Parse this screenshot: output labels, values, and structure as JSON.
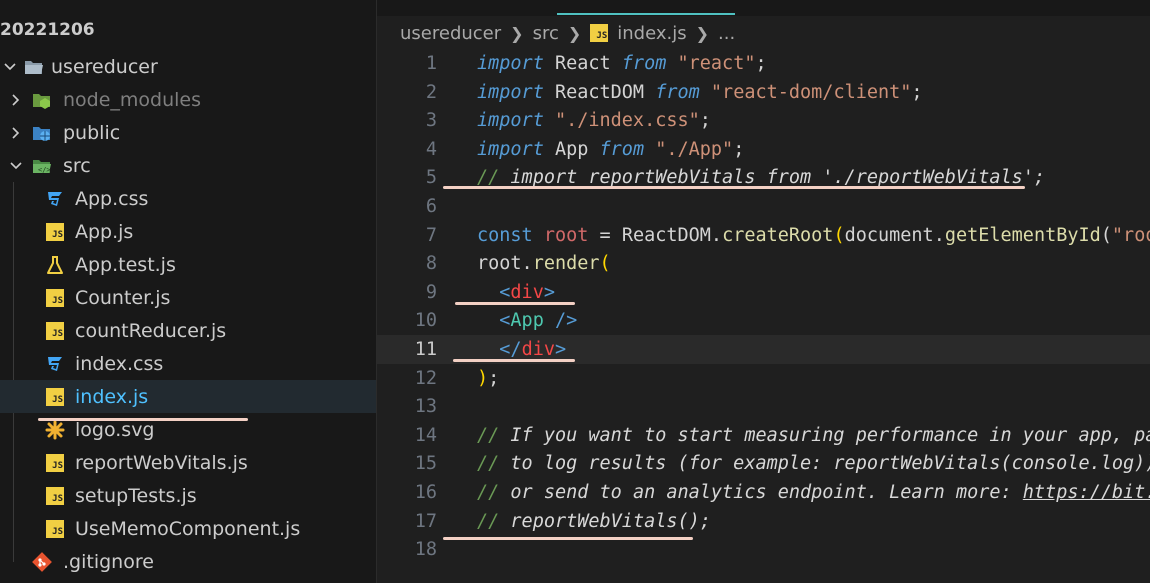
{
  "sidebar": {
    "root_folder": "20221206",
    "tree": [
      {
        "label": "usereducer",
        "kind": "folder",
        "icon": "folder-open-icon",
        "expanded": true,
        "depth": 0
      },
      {
        "label": "node_modules",
        "kind": "folder",
        "icon": "node-folder-icon",
        "expanded": false,
        "depth": 1,
        "dim": true
      },
      {
        "label": "public",
        "kind": "folder",
        "icon": "public-folder-icon",
        "expanded": false,
        "depth": 1
      },
      {
        "label": "src",
        "kind": "folder",
        "icon": "src-folder-icon",
        "expanded": true,
        "depth": 1
      },
      {
        "label": "App.css",
        "kind": "file",
        "icon": "css-file-icon",
        "depth": 2
      },
      {
        "label": "App.js",
        "kind": "file",
        "icon": "js-file-icon",
        "depth": 2
      },
      {
        "label": "App.test.js",
        "kind": "file",
        "icon": "test-flask-icon",
        "depth": 2
      },
      {
        "label": "Counter.js",
        "kind": "file",
        "icon": "js-file-icon",
        "depth": 2
      },
      {
        "label": "countReducer.js",
        "kind": "file",
        "icon": "js-file-icon",
        "depth": 2
      },
      {
        "label": "index.css",
        "kind": "file",
        "icon": "css-file-icon",
        "depth": 2
      },
      {
        "label": "index.js",
        "kind": "file",
        "icon": "js-file-icon",
        "depth": 2,
        "selected": true
      },
      {
        "label": "logo.svg",
        "kind": "file",
        "icon": "svg-file-icon",
        "depth": 2
      },
      {
        "label": "reportWebVitals.js",
        "kind": "file",
        "icon": "js-file-icon",
        "depth": 2
      },
      {
        "label": "setupTests.js",
        "kind": "file",
        "icon": "js-file-icon",
        "depth": 2
      },
      {
        "label": "UseMemoComponent.js",
        "kind": "file",
        "icon": "js-file-icon",
        "depth": 2
      },
      {
        "label": ".gitignore",
        "kind": "file",
        "icon": "git-file-icon",
        "depth": 1
      }
    ]
  },
  "editor": {
    "breadcrumb": [
      "usereducer",
      "src",
      "index.js",
      "..."
    ],
    "breadcrumb_file_badge": "JS",
    "current_line": 11,
    "lines": [
      {
        "n": 1,
        "tokens": [
          [
            "kw",
            "import"
          ],
          [
            "t",
            " React "
          ],
          [
            "kw",
            "from"
          ],
          [
            "t",
            " "
          ],
          [
            "str",
            "\"react\""
          ],
          [
            "t",
            ";"
          ]
        ]
      },
      {
        "n": 2,
        "tokens": [
          [
            "kw",
            "import"
          ],
          [
            "t",
            " ReactDOM "
          ],
          [
            "kw",
            "from"
          ],
          [
            "t",
            " "
          ],
          [
            "str",
            "\"react-dom/client\""
          ],
          [
            "t",
            ";"
          ]
        ]
      },
      {
        "n": 3,
        "tokens": [
          [
            "kw",
            "import"
          ],
          [
            "t",
            " "
          ],
          [
            "str",
            "\"./index.css\""
          ],
          [
            "t",
            ";"
          ]
        ]
      },
      {
        "n": 4,
        "tokens": [
          [
            "kw",
            "import"
          ],
          [
            "t",
            " App "
          ],
          [
            "kw",
            "from"
          ],
          [
            "t",
            " "
          ],
          [
            "str",
            "\"./App\""
          ],
          [
            "t",
            ";"
          ]
        ]
      },
      {
        "n": 5,
        "tokens": [
          [
            "cm",
            "// "
          ],
          [
            "cmt",
            "import reportWebVitals from './reportWebVitals';"
          ]
        ]
      },
      {
        "n": 6,
        "tokens": []
      },
      {
        "n": 7,
        "tokens": [
          [
            "kw2",
            "const"
          ],
          [
            "t",
            " "
          ],
          [
            "kwc",
            "root"
          ],
          [
            "t",
            " = ReactDOM."
          ],
          [
            "fn",
            "createRoot"
          ],
          [
            "bp",
            "("
          ],
          [
            "t",
            "document."
          ],
          [
            "fn",
            "getElementById"
          ],
          [
            "t",
            "("
          ],
          [
            "str",
            "\"root\""
          ],
          [
            "t",
            ")"
          ],
          [
            "bp",
            ")"
          ],
          [
            "t",
            ";"
          ]
        ]
      },
      {
        "n": 8,
        "tokens": [
          [
            "t",
            "root."
          ],
          [
            "fn",
            "render"
          ],
          [
            "bp",
            "("
          ]
        ]
      },
      {
        "n": 9,
        "tokens": [
          [
            "t",
            "  "
          ],
          [
            "tag",
            "<"
          ],
          [
            "tagname",
            "div"
          ],
          [
            "tag",
            ">"
          ]
        ]
      },
      {
        "n": 10,
        "tokens": [
          [
            "t",
            "  "
          ],
          [
            "tag",
            "<"
          ],
          [
            "comp",
            "App"
          ],
          [
            "t",
            " "
          ],
          [
            "tag",
            "/>"
          ]
        ]
      },
      {
        "n": 11,
        "tokens": [
          [
            "t",
            "  "
          ],
          [
            "tag",
            "</"
          ],
          [
            "tagname",
            "div"
          ],
          [
            "tag",
            ">"
          ]
        ]
      },
      {
        "n": 12,
        "tokens": [
          [
            "bp",
            ")"
          ],
          [
            "t",
            ";"
          ]
        ]
      },
      {
        "n": 13,
        "tokens": []
      },
      {
        "n": 14,
        "tokens": [
          [
            "cm",
            "// "
          ],
          [
            "cmt",
            "If you want to start measuring performance in your app, pass a"
          ]
        ]
      },
      {
        "n": 15,
        "tokens": [
          [
            "cm",
            "// "
          ],
          [
            "cmt",
            "to log results (for example: reportWebVitals(console.log))"
          ]
        ]
      },
      {
        "n": 16,
        "tokens": [
          [
            "cm",
            "// "
          ],
          [
            "cmt",
            "or send to an analytics endpoint. Learn more: "
          ],
          [
            "lnk",
            "https://bit.ly/CRA-vitals"
          ]
        ]
      },
      {
        "n": 17,
        "tokens": [
          [
            "cm",
            "// "
          ],
          [
            "cmt",
            "reportWebVitals();"
          ]
        ]
      },
      {
        "n": 18,
        "tokens": []
      }
    ]
  },
  "colors": {
    "annotation_underline": "#f3d0c4",
    "tab_accent": "#4fc1c1",
    "js_badge": "#f1cf43"
  }
}
